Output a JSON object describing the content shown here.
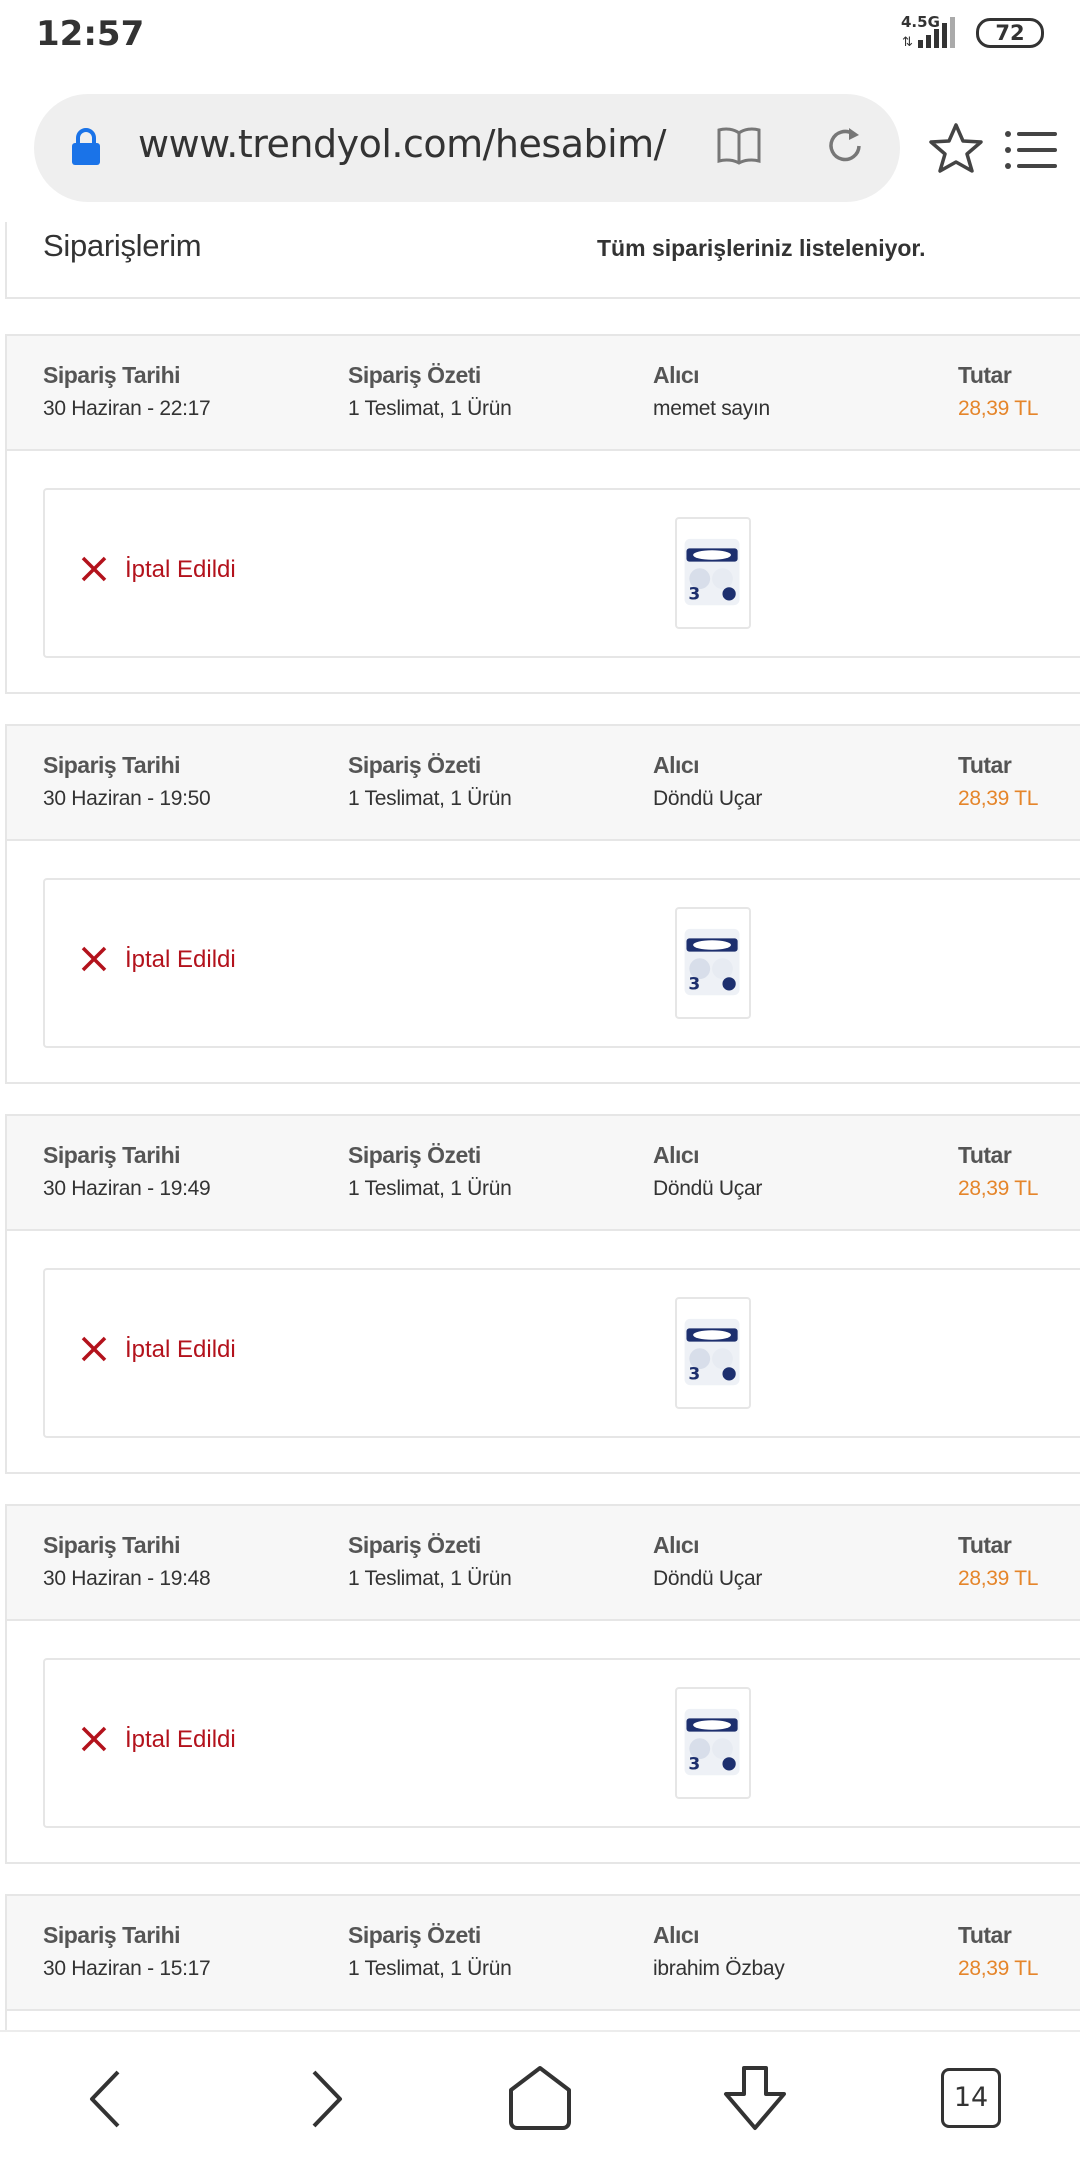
{
  "status_bar": {
    "time": "12:57",
    "network": "4.5G",
    "battery": "72"
  },
  "browser": {
    "url": "www.trendyol.com/hesabim/s",
    "tab_count": "14"
  },
  "page": {
    "title": "Siparişlerim",
    "subtitle": "Tüm siparişleriniz listeleniyor."
  },
  "labels": {
    "date": "Sipariş Tarihi",
    "summary": "Sipariş Özeti",
    "recipient": "Alıcı",
    "total": "Tutar"
  },
  "orders": [
    {
      "date": "30 Haziran - 22:17",
      "summary": "1 Teslimat, 1 Ürün",
      "recipient": "memet sayın",
      "total": "28,39 TL",
      "status": "İptal Edildi"
    },
    {
      "date": "30 Haziran - 19:50",
      "summary": "1 Teslimat, 1 Ürün",
      "recipient": "Döndü Uçar",
      "total": "28,39 TL",
      "status": "İptal Edildi"
    },
    {
      "date": "30 Haziran - 19:49",
      "summary": "1 Teslimat, 1 Ürün",
      "recipient": "Döndü Uçar",
      "total": "28,39 TL",
      "status": "İptal Edildi"
    },
    {
      "date": "30 Haziran - 19:48",
      "summary": "1 Teslimat, 1 Ürün",
      "recipient": "Döndü Uçar",
      "total": "28,39 TL",
      "status": "İptal Edildi"
    },
    {
      "date": "30 Haziran - 15:17",
      "summary": "1 Teslimat, 1 Ürün",
      "recipient": "ibrahim Özbay",
      "total": "28,39 TL",
      "status": ""
    }
  ],
  "colors": {
    "price": "#e5852a",
    "cancelled": "#b3121c",
    "lock": "#1a73e8"
  }
}
